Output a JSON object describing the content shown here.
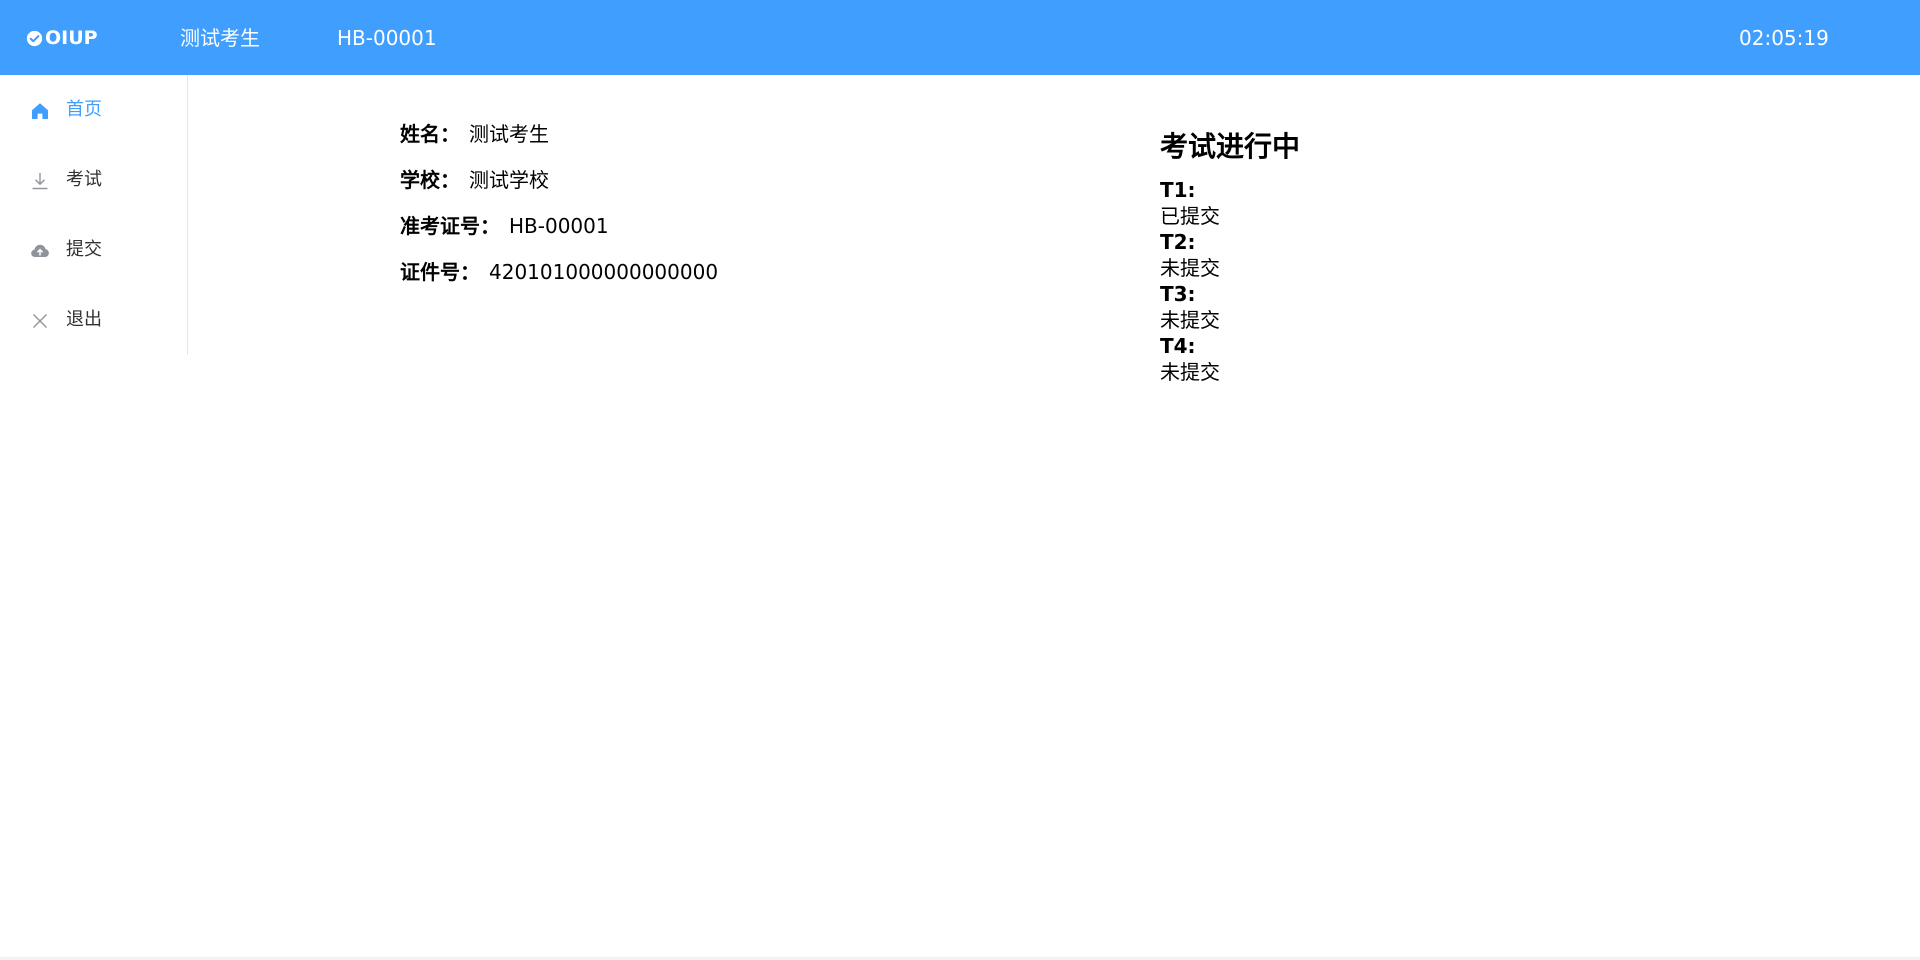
{
  "header": {
    "logo_text": "OIUP",
    "student_name": "测试考生",
    "ticket_no": "HB-00001",
    "time": "02:05:19",
    "background_color": "#409eff"
  },
  "sidebar": {
    "items": [
      {
        "label": "首页",
        "icon": "home-icon",
        "active": true
      },
      {
        "label": "考试",
        "icon": "download-icon",
        "active": false
      },
      {
        "label": "提交",
        "icon": "cloud-upload-icon",
        "active": false
      },
      {
        "label": "退出",
        "icon": "close-icon",
        "active": false
      }
    ],
    "active_color": "#409eff"
  },
  "profile": {
    "name_label": "姓名：",
    "name_value": "测试考生",
    "school_label": "学校：",
    "school_value": "测试学校",
    "ticket_label": "准考证号：",
    "ticket_value": "HB-00001",
    "id_label": "证件号：",
    "id_value": "420101000000000000"
  },
  "exam": {
    "status_title": "考试进行中",
    "tasks": [
      {
        "name": "T1:",
        "status": "已提交"
      },
      {
        "name": "T2:",
        "status": "未提交"
      },
      {
        "name": "T3:",
        "status": "未提交"
      },
      {
        "name": "T4:",
        "status": "未提交"
      }
    ]
  }
}
